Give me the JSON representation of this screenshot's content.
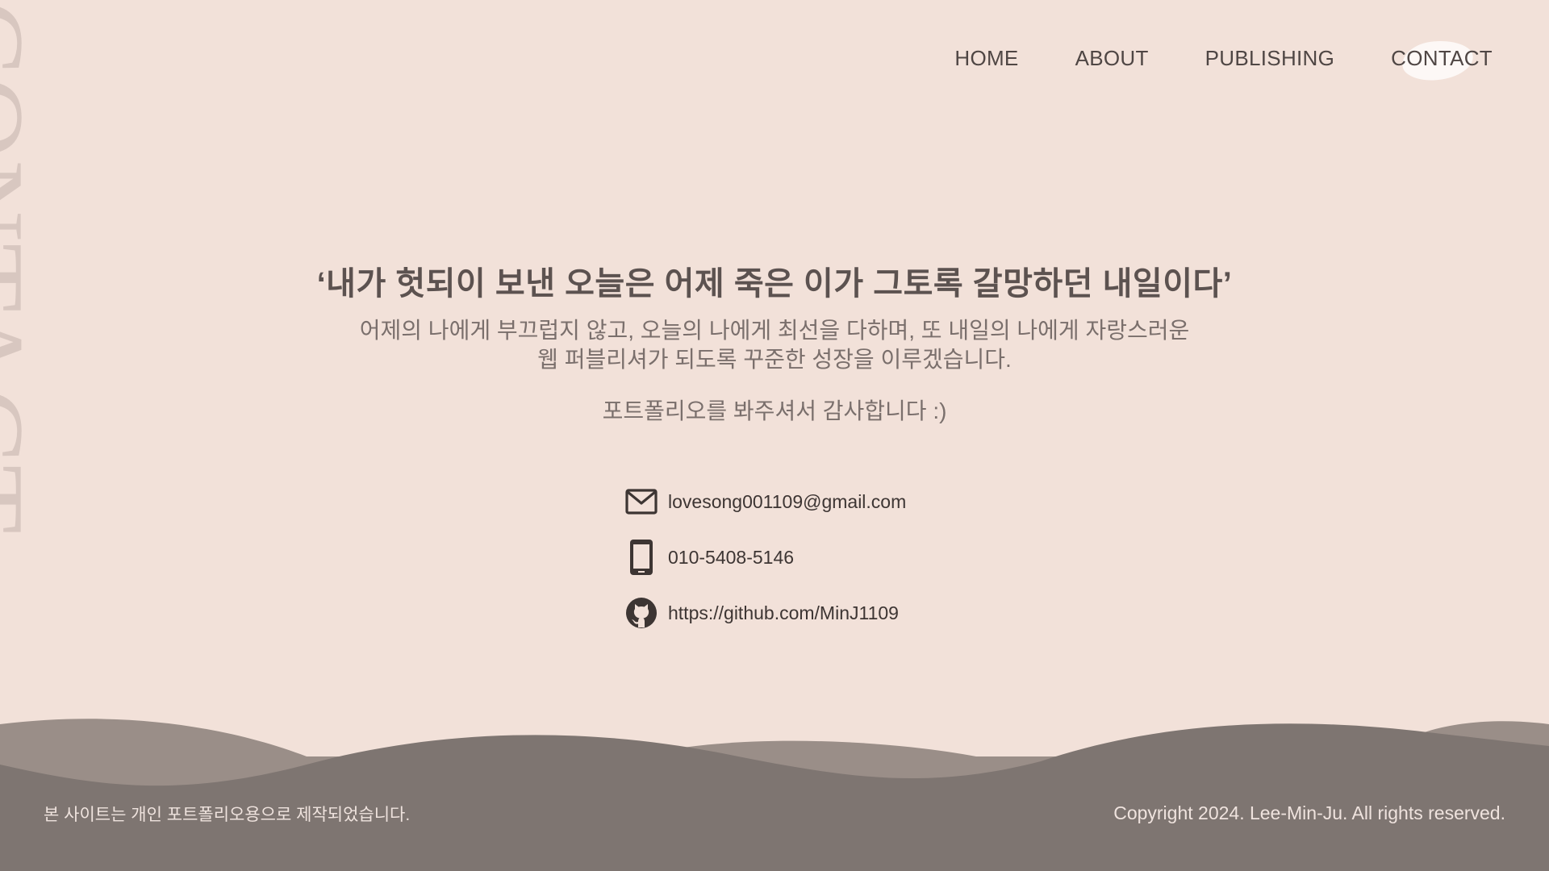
{
  "side_title": "CONTACT",
  "nav": {
    "items": [
      {
        "label": "HOME",
        "active": false
      },
      {
        "label": "ABOUT",
        "active": false
      },
      {
        "label": "PUBLISHING",
        "active": false
      },
      {
        "label": "CONTACT",
        "active": true
      }
    ]
  },
  "main": {
    "quote": "‘내가 헛되이 보낸 오늘은 어제 죽은 이가 그토록 갈망하던 내일이다’",
    "desc_line1": "어제의 나에게 부끄럽지 않고, 오늘의 나에게 최선을 다하며, 또 내일의 나에게 자랑스러운",
    "desc_line2": "웹 퍼블리셔가 되도록 꾸준한 성장을 이루겠습니다.",
    "thanks": "포트폴리오를 봐주셔서 감사합니다 :)"
  },
  "contacts": [
    {
      "icon": "mail-icon",
      "text": "lovesong001109@gmail.com"
    },
    {
      "icon": "phone-icon",
      "text": "010-5408-5146"
    },
    {
      "icon": "github-icon",
      "text": "https://github.com/MinJ1109"
    }
  ],
  "footer": {
    "left": "본 사이트는 개인 포트폴리오용으로 제작되었습니다.",
    "right": "Copyright 2024. Lee-Min-Ju. All rights reserved."
  },
  "colors": {
    "background": "#f2e1d9",
    "wave_light": "#9a8e88",
    "wave_dark": "#7e7571",
    "text": "#4f4644",
    "side_title": "#d8c7c0",
    "active_blob": "#fdf8f6"
  }
}
